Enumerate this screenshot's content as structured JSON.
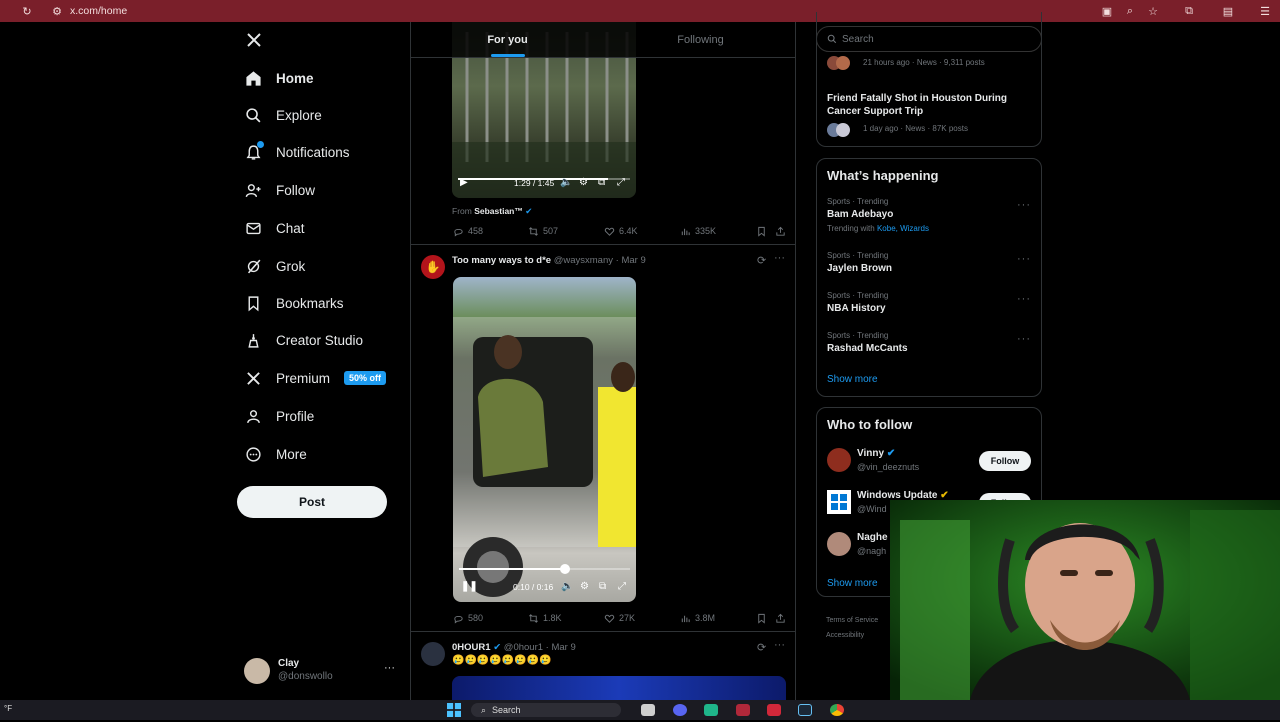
{
  "browser": {
    "url": "x.com/home"
  },
  "nav": {
    "items": [
      {
        "label": "Home",
        "icon": "home-icon",
        "active": true
      },
      {
        "label": "Explore",
        "icon": "search-icon"
      },
      {
        "label": "Notifications",
        "icon": "bell-icon"
      },
      {
        "label": "Follow",
        "icon": "person-plus-icon"
      },
      {
        "label": "Chat",
        "icon": "mail-icon"
      },
      {
        "label": "Grok",
        "icon": "grok-icon"
      },
      {
        "label": "Bookmarks",
        "icon": "bookmark-icon"
      },
      {
        "label": "Creator Studio",
        "icon": "creator-icon"
      },
      {
        "label": "Premium",
        "icon": "x-logo-icon",
        "badge": "50% off"
      },
      {
        "label": "Profile",
        "icon": "user-icon"
      },
      {
        "label": "More",
        "icon": "more-circle-icon"
      }
    ],
    "post_label": "Post",
    "account": {
      "name": "Clay",
      "handle": "@donswollo"
    }
  },
  "tabs": [
    {
      "label": "For you",
      "active": true
    },
    {
      "label": "Following",
      "active": false
    }
  ],
  "posts": [
    {
      "video": {
        "time": "1:29 / 1:45",
        "progress": 0.87,
        "playing": false
      },
      "from_label": "From",
      "from_name": "Sebastian™",
      "stats": {
        "replies": "458",
        "reposts": "507",
        "likes": "6.4K",
        "views": "335K"
      }
    },
    {
      "author": "Too many ways to d*e",
      "handle": "@waysxmany",
      "date": "· Mar 9",
      "video": {
        "time": "0:10 / 0:16",
        "progress": 0.62,
        "playing": true
      },
      "stats": {
        "replies": "580",
        "reposts": "1.8K",
        "likes": "27K",
        "views": "3.8M"
      }
    },
    {
      "author": "0HOUR1",
      "handle": "@0hour1",
      "date": "· Mar 9",
      "text": "🥲🥲🥲🥲🥲🥲🥲🥲"
    }
  ],
  "right": {
    "search_placeholder": "Search",
    "news": [
      {
        "meta": "21 hours ago · News · 9,311 posts"
      },
      {
        "title": "Friend Fatally Shot in Houston During Cancer Support Trip",
        "meta": "1 day ago · News · 87K posts"
      }
    ],
    "happening": {
      "title": "What’s happening",
      "trends": [
        {
          "meta": "Sports · Trending",
          "name": "Bam Adebayo",
          "with_label": "Trending with",
          "with": "Kobe, Wizards"
        },
        {
          "meta": "Sports · Trending",
          "name": "Jaylen Brown"
        },
        {
          "meta": "Sports · Trending",
          "name": "NBA History"
        },
        {
          "meta": "Sports · Trending",
          "name": "Rashad McCants"
        }
      ],
      "show_more": "Show more"
    },
    "who_to_follow": {
      "title": "Who to follow",
      "users": [
        {
          "name": "Vinny",
          "handle": "@vin_deeznuts",
          "button": "Follow"
        },
        {
          "name": "Windows Update",
          "handle": "@Wind",
          "button": "Follow"
        },
        {
          "name": "Naghe",
          "handle": "@nagh"
        }
      ],
      "show_more": "Show more"
    },
    "footer": [
      "Terms of Service",
      "Accessibility"
    ]
  },
  "taskbar": {
    "search": "Search",
    "weather": "°F"
  },
  "colors": {
    "accent": "#1d9bf0",
    "browser_bar": "#7a1f2a",
    "background": "#000000",
    "border": "#2f3336"
  }
}
